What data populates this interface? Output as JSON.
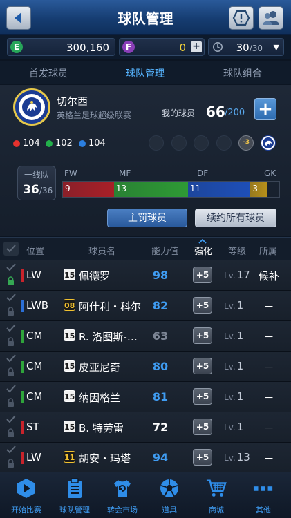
{
  "header": {
    "title": "球队管理"
  },
  "currency": {
    "e": {
      "badge": "E",
      "value": "300,160",
      "color": "#27a65a"
    },
    "f": {
      "badge": "F",
      "value": "0",
      "color": "#8a3fb8",
      "plus": "+"
    },
    "energy": {
      "current": "30",
      "max": "/30",
      "caret": "▼"
    }
  },
  "tabs": [
    {
      "label": "首发球员"
    },
    {
      "label": "球队管理"
    },
    {
      "label": "球队组合"
    }
  ],
  "team": {
    "name": "切尔西",
    "league": "英格兰足球超级联赛",
    "my_players_label": "我的球员",
    "my_players_count": "66",
    "my_players_max": "/200",
    "add_label": "+",
    "stats": [
      {
        "value": "104",
        "color": "#e8322e"
      },
      {
        "value": "102",
        "color": "#22b04a"
      },
      {
        "value": "104",
        "color": "#2b7fe0"
      }
    ],
    "badge_count": "-3",
    "first_team": {
      "label": "一线队",
      "count": "36",
      "max": "/36"
    },
    "positions": [
      {
        "label": "FW",
        "count": "9",
        "fraction": 0.236,
        "color": "#a82028"
      },
      {
        "label": "MF",
        "count": "13",
        "fraction": 0.342,
        "color": "#2e9a35"
      },
      {
        "label": "DF",
        "count": "11",
        "fraction": 0.289,
        "color": "#1e4fb8"
      },
      {
        "label": "GK",
        "count": "3",
        "fraction": 0.079,
        "color": "#b8901a"
      }
    ],
    "buttons": {
      "set_piece": "主罚球员",
      "renew_all": "续约所有球员"
    }
  },
  "table": {
    "headers": {
      "position": "位置",
      "name": "球员名",
      "rating": "能力值",
      "enhance": "强化",
      "level": "等级",
      "belong": "所属"
    },
    "rows": [
      {
        "pos": "LW",
        "pos_color": "#c8232b",
        "season": "15",
        "season_style": "dark",
        "name": "佩德罗",
        "rating": "98",
        "rating_color": "#3f9cf2",
        "enhance": "+5",
        "lvl_prefix": "Lv.",
        "level": "17",
        "status": "候补",
        "locked": true
      },
      {
        "pos": "LWB",
        "pos_color": "#2b6fd6",
        "season": "08",
        "season_style": "gold",
        "name": "阿什利・科尔",
        "rating": "82",
        "rating_color": "#3f9cf2",
        "enhance": "+5",
        "lvl_prefix": "Lv.",
        "level": "1",
        "status": "－",
        "locked": false
      },
      {
        "pos": "CM",
        "pos_color": "#2fa43b",
        "season": "15",
        "season_style": "dark",
        "name": "R. 洛图斯-…",
        "rating": "63",
        "rating_color": "#7c8594",
        "enhance": "+5",
        "lvl_prefix": "Lv.",
        "level": "1",
        "status": "－",
        "locked": false
      },
      {
        "pos": "CM",
        "pos_color": "#2fa43b",
        "season": "15",
        "season_style": "dark",
        "name": "皮亚尼奇",
        "rating": "80",
        "rating_color": "#3f9cf2",
        "enhance": "+5",
        "lvl_prefix": "Lv.",
        "level": "1",
        "status": "－",
        "locked": false
      },
      {
        "pos": "CM",
        "pos_color": "#2fa43b",
        "season": "15",
        "season_style": "dark",
        "name": "纳因格兰",
        "rating": "81",
        "rating_color": "#3f9cf2",
        "enhance": "+5",
        "lvl_prefix": "Lv.",
        "level": "1",
        "status": "－",
        "locked": false
      },
      {
        "pos": "ST",
        "pos_color": "#c8232b",
        "season": "15",
        "season_style": "dark",
        "name": "B. 特劳雷",
        "rating": "72",
        "rating_color": "#ffffff",
        "enhance": "+5",
        "lvl_prefix": "Lv.",
        "level": "1",
        "status": "－",
        "locked": false
      },
      {
        "pos": "LW",
        "pos_color": "#c8232b",
        "season": "11",
        "season_style": "gold",
        "name": "胡安・玛塔",
        "rating": "94",
        "rating_color": "#3f9cf2",
        "enhance": "+5",
        "lvl_prefix": "Lv.",
        "level": "13",
        "status": "－",
        "locked": false
      }
    ]
  },
  "nav": [
    {
      "label": "开始比赛",
      "icon": "play-icon"
    },
    {
      "label": "球队管理",
      "icon": "clipboard-icon"
    },
    {
      "label": "转会市场",
      "icon": "transfer-shirt-icon"
    },
    {
      "label": "道具",
      "icon": "football-icon"
    },
    {
      "label": "商城",
      "icon": "cart-icon"
    },
    {
      "label": "其他",
      "icon": "more-icon"
    }
  ]
}
